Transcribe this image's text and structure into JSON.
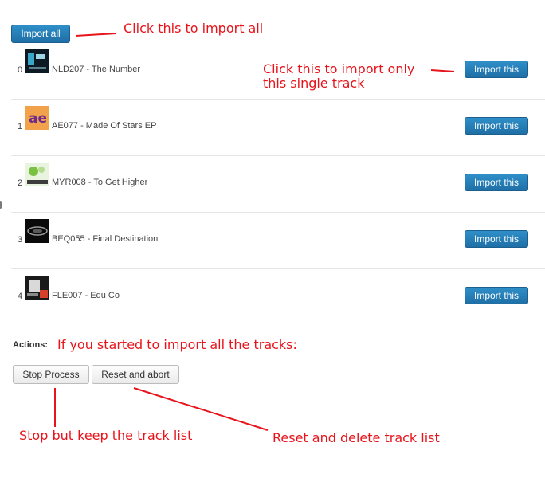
{
  "toolbar": {
    "import_all_label": "Import all"
  },
  "tracks": [
    {
      "index": "0",
      "title": "NLD207 - The Number",
      "button": "Import this"
    },
    {
      "index": "1",
      "title": "AE077 - Made Of Stars EP",
      "button": "Import this"
    },
    {
      "index": "2",
      "title": "MYR008 - To Get Higher",
      "button": "Import this"
    },
    {
      "index": "3",
      "title": "BEQ055 - Final Destination",
      "button": "Import this"
    },
    {
      "index": "4",
      "title": "FLE007 - Edu Co",
      "button": "Import this"
    }
  ],
  "actions": {
    "label": "Actions:",
    "stop_label": "Stop Process",
    "reset_label": "Reset and abort"
  },
  "annotations": {
    "import_all": "Click this to import all",
    "import_single_line1": "Click this to import only",
    "import_single_line2": "this single track",
    "started_all": "If you started to import all the tracks:",
    "stop_note": "Stop but keep the track list",
    "reset_note": "Reset and delete track list"
  },
  "colors": {
    "annotation": "#e8141b",
    "button_primary": "#2279b5"
  }
}
